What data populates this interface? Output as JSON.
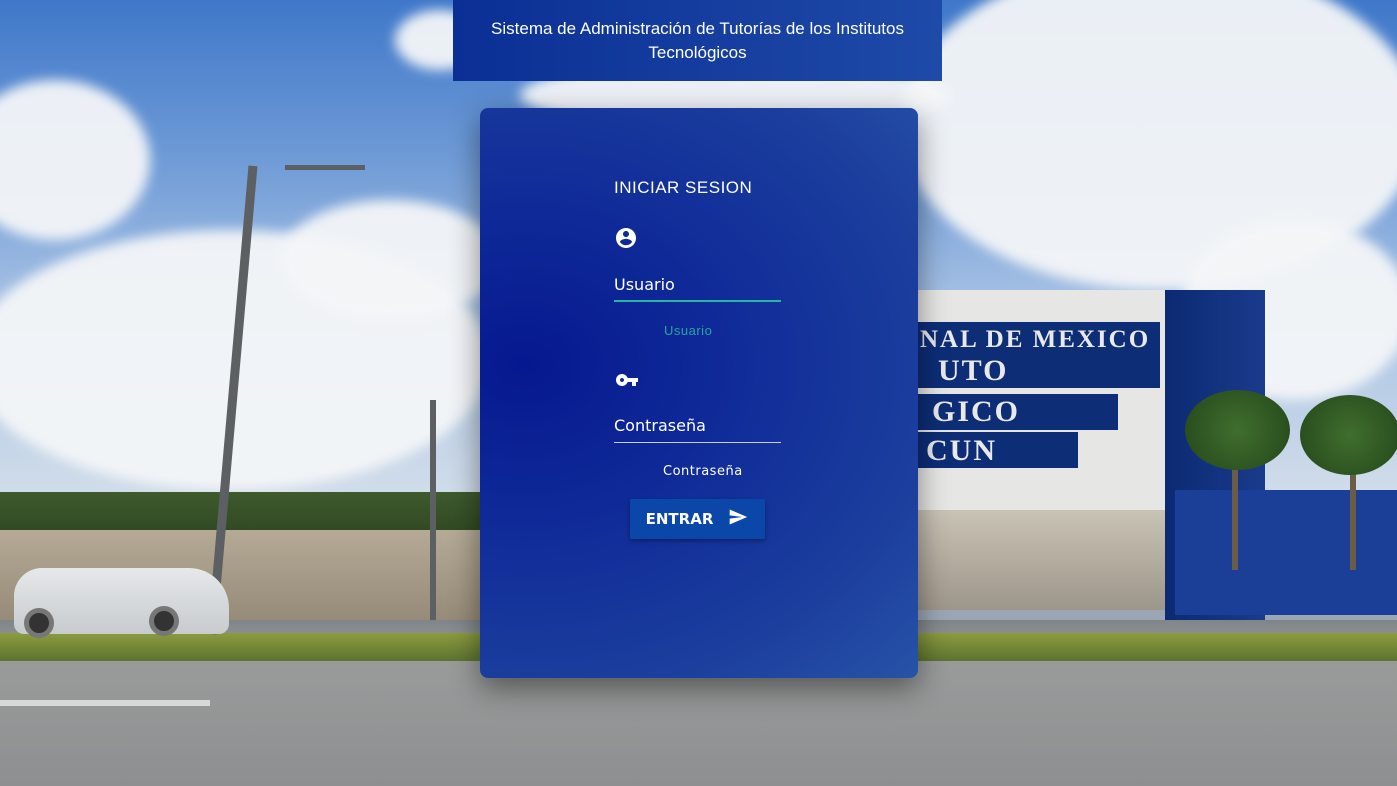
{
  "header": {
    "title": "Sistema de Administración de Tutorías de los Institutos Tecnológicos"
  },
  "background": {
    "sign_lines": [
      "NAL DE MEXICO",
      "UTO",
      "GICO",
      "CUN"
    ]
  },
  "login": {
    "title": "INICIAR SESION",
    "user_icon": "account-circle-icon",
    "user_placeholder": "Usuario",
    "user_helper": "Usuario",
    "password_icon": "key-icon",
    "password_placeholder": "Contraseña",
    "password_helper": "Contraseña",
    "submit_label": "ENTRAR",
    "submit_icon": "send-icon"
  },
  "colors": {
    "header_bg": "#0b2f95",
    "card_bg": "#0f2a98",
    "button_bg": "#0a47a9",
    "focus_accent": "#26a69a",
    "text": "#ffffff"
  }
}
